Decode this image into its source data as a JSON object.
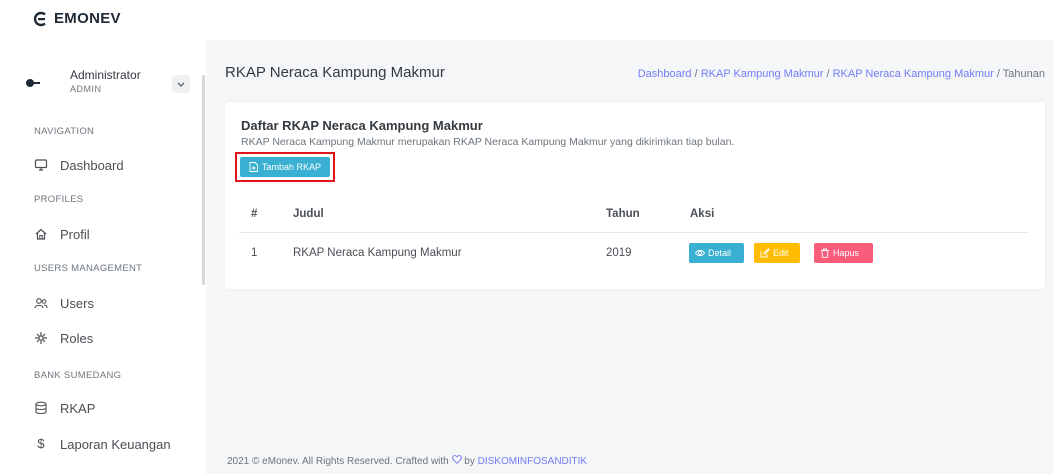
{
  "app": {
    "logo_text": "EMONEV"
  },
  "user": {
    "name": "Administrator",
    "role": "ADMIN"
  },
  "sidebar": {
    "sections": [
      {
        "label": "NAVIGATION"
      },
      {
        "label": "PROFILES"
      },
      {
        "label": "USERS MANAGEMENT"
      },
      {
        "label": "BANK SUMEDANG"
      }
    ],
    "items": [
      {
        "label": "Dashboard",
        "icon": "monitor-icon"
      },
      {
        "label": "Profil",
        "icon": "home-icon"
      },
      {
        "label": "Users",
        "icon": "users-icon"
      },
      {
        "label": "Roles",
        "icon": "roles-icon"
      },
      {
        "label": "RKAP",
        "icon": "database-icon"
      },
      {
        "label": "Laporan Keuangan",
        "icon": "dollar-icon"
      }
    ]
  },
  "page": {
    "title": "RKAP Neraca Kampung Makmur",
    "breadcrumb": [
      {
        "label": "Dashboard"
      },
      {
        "label": "RKAP Kampung Makmur"
      },
      {
        "label": "RKAP Neraca Kampung Makmur"
      },
      {
        "label": "Tahunan"
      }
    ],
    "separator": "/"
  },
  "card": {
    "title": "Daftar RKAP Neraca Kampung Makmur",
    "description": "RKAP Neraca Kampung Makmur merupakan RKAP Neraca Kampung Makmur yang dikirimkan tiap bulan.",
    "add_button_label": "Tambah RKAP"
  },
  "table": {
    "columns": [
      "#",
      "Judul",
      "Tahun",
      "Aksi"
    ],
    "rows": [
      {
        "no": "1",
        "judul": "RKAP Neraca Kampung Makmur",
        "tahun": "2019"
      }
    ],
    "actions": {
      "detail": "Detail",
      "edit": "Edit",
      "hapus": "Hapus"
    }
  },
  "footer": {
    "text": "2021 © eMonev. All Rights Reserved. Crafted with",
    "by": "by",
    "link": "DISKOMINFOSANDITIK"
  },
  "colors": {
    "accent": "#727cf5",
    "info": "#39afd1",
    "warning": "#ffbc00",
    "danger": "#fa5c7c",
    "highlight": "#e0141b"
  }
}
